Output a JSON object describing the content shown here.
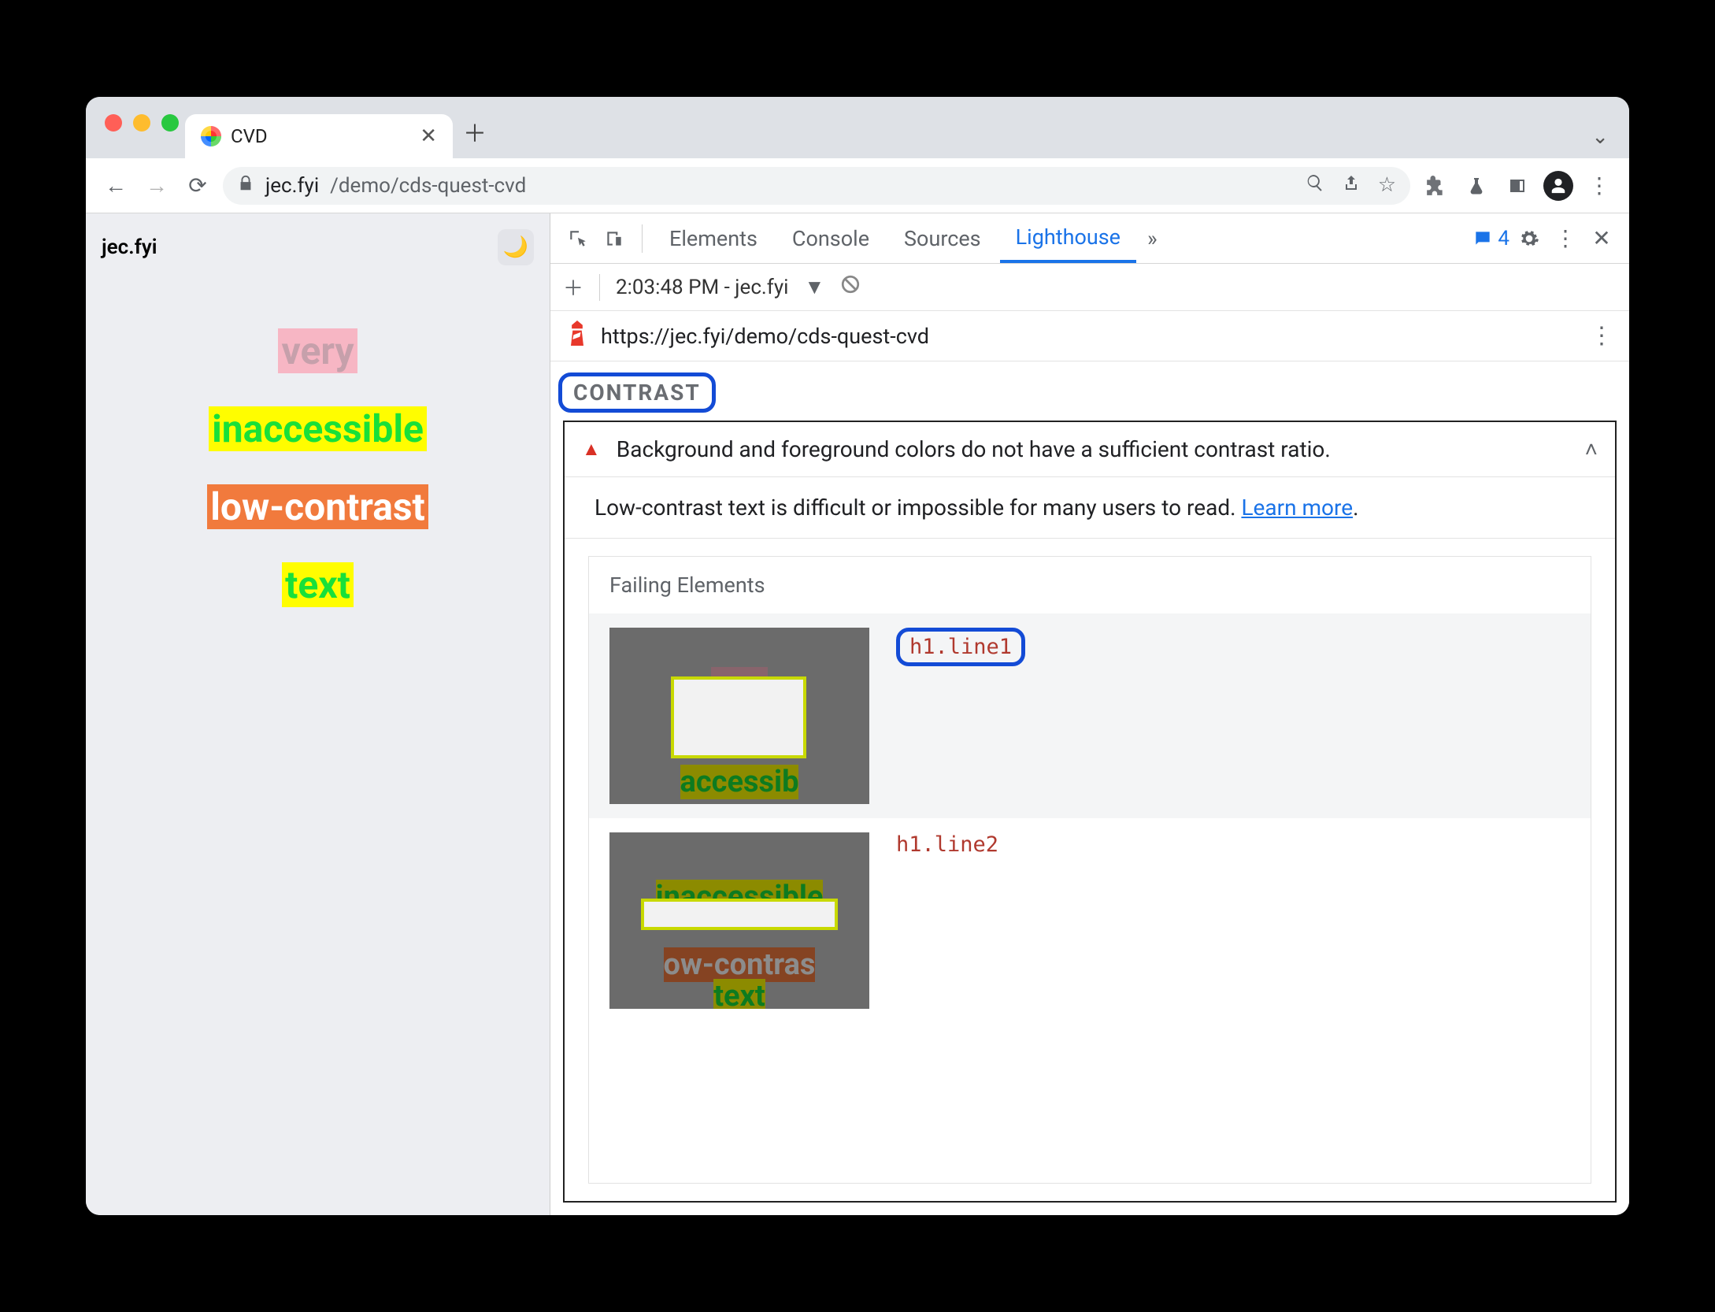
{
  "browser": {
    "tab_title": "CVD",
    "url_host": "jec.fyi",
    "url_path": "/demo/cds-quest-cvd"
  },
  "page": {
    "site_title": "jec.fyi",
    "lines": [
      "very",
      "inaccessible",
      "low-contrast",
      "text"
    ]
  },
  "devtools": {
    "tabs": {
      "elements": "Elements",
      "console": "Console",
      "sources": "Sources",
      "lighthouse": "Lighthouse",
      "more": "»"
    },
    "messages_badge": "4",
    "subbar": {
      "snapshot_label": "2:03:48 PM - jec.fyi"
    },
    "lighthouse": {
      "url": "https://jec.fyi/demo/cds-quest-cvd",
      "section_label": "CONTRAST",
      "audit_title": "Background and foreground colors do not have a sufficient contrast ratio.",
      "audit_desc": "Low-contrast text is difficult or impossible for many users to read. ",
      "learn_more": "Learn more",
      "failing_header": "Failing Elements",
      "failing": [
        {
          "selector": "h1.line1"
        },
        {
          "selector": "h1.line2"
        }
      ]
    }
  }
}
